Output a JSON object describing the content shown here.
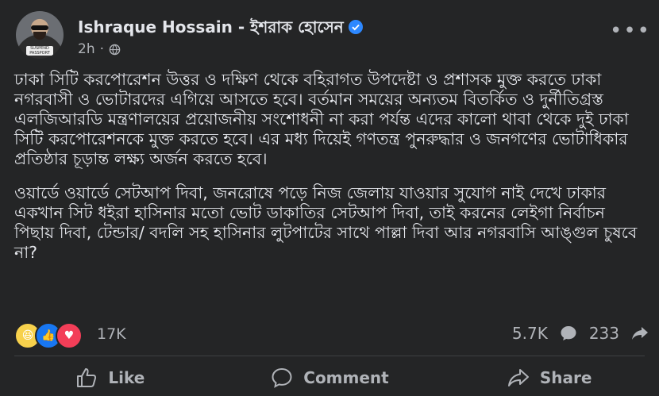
{
  "post": {
    "author": "Ishraque Hossain - ইশরাক হোসেন",
    "time": "2h",
    "avatar_badge": "SUSPEND PASSPORT",
    "paragraphs": [
      "ঢাকা সিটি করপোরেশন উত্তর ও দক্ষিণ থেকে বহিরাগত উপদেষ্টা ও প্রশাসক মুক্ত করতে ঢাকা নগরবাসী ও ভোটারদের এগিয়ে আসতে হবে। বর্তমান সময়ের অন্যতম বিতর্কিত ও দুর্নীতিগ্রস্ত এলজিআরডি মন্ত্রণালয়ের প্রয়োজনীয় সংশোধনী না করা পর্যন্ত এদের কালো থাবা থেকে দুই ঢাকা সিটি করপোরেশনকে মুক্ত করতে হবে। এর মধ্য দিয়েই গণতন্ত্র পুনরুদ্ধার ও জনগণের ভোটাধিকার প্রতিষ্ঠার চূড়ান্ত লক্ষ্য অর্জন করতে হবে।",
      "ওয়ার্ডে ওয়ার্ডে সেটআপ দিবা, জনরোষে পড়ে নিজ জেলায় যাওয়ার সুযোগ নাই দেখে ঢাকার একখান সিট ধইরা হাসিনার মতো ভোট ডাকাতির সেটআপ দিবা, তাই করনের লেইগা নির্বাচন পিছায় দিবা, টেন্ডার/ বদলি সহ হাসিনার লুটপাটের সাথে পাল্লা দিবা আর নগরবাসি আঙ্গুল চুষবে না?"
    ]
  },
  "stats": {
    "reactions_count": "17K",
    "comments_count": "5.7K",
    "shares_count": "233"
  },
  "actions": {
    "like": "Like",
    "comment": "Comment",
    "share": "Share"
  },
  "colors": {
    "background": "#242526",
    "text": "#e4e6eb",
    "secondary": "#b0b3b8",
    "verified": "#2d88ff"
  }
}
